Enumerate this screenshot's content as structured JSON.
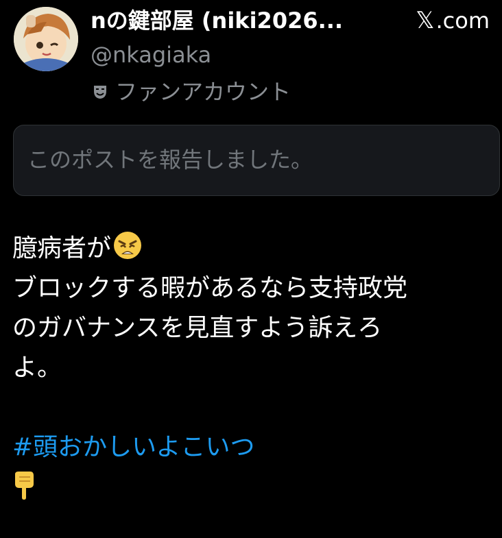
{
  "author": {
    "display_name": "nの鍵部屋 (niki2026...",
    "handle": "@nkagiaka",
    "account_type": "ファンアカウント",
    "account_type_icon": "theater-mask-icon"
  },
  "site": {
    "logo_icon": "x-logo-icon",
    "name": ".com"
  },
  "notice": {
    "text": "このポストを報告しました。"
  },
  "post": {
    "line1": "臆病者が",
    "line1_emoji": "weary-face-emoji",
    "line2": "ブロックする暇があるなら支持政党",
    "line3": "のガバナンスを見直すよう訴えろ",
    "line4": "よ。",
    "hashtag": "#頭おかしいよこいつ",
    "final_emoji": "pointing-down-hand-emoji"
  },
  "colors": {
    "background": "#000000",
    "text_primary": "#ffffff",
    "text_secondary": "#8b8f94",
    "hashtag": "#1d9bf0",
    "notice_bg": "#16181c",
    "notice_border": "#2f3336"
  }
}
